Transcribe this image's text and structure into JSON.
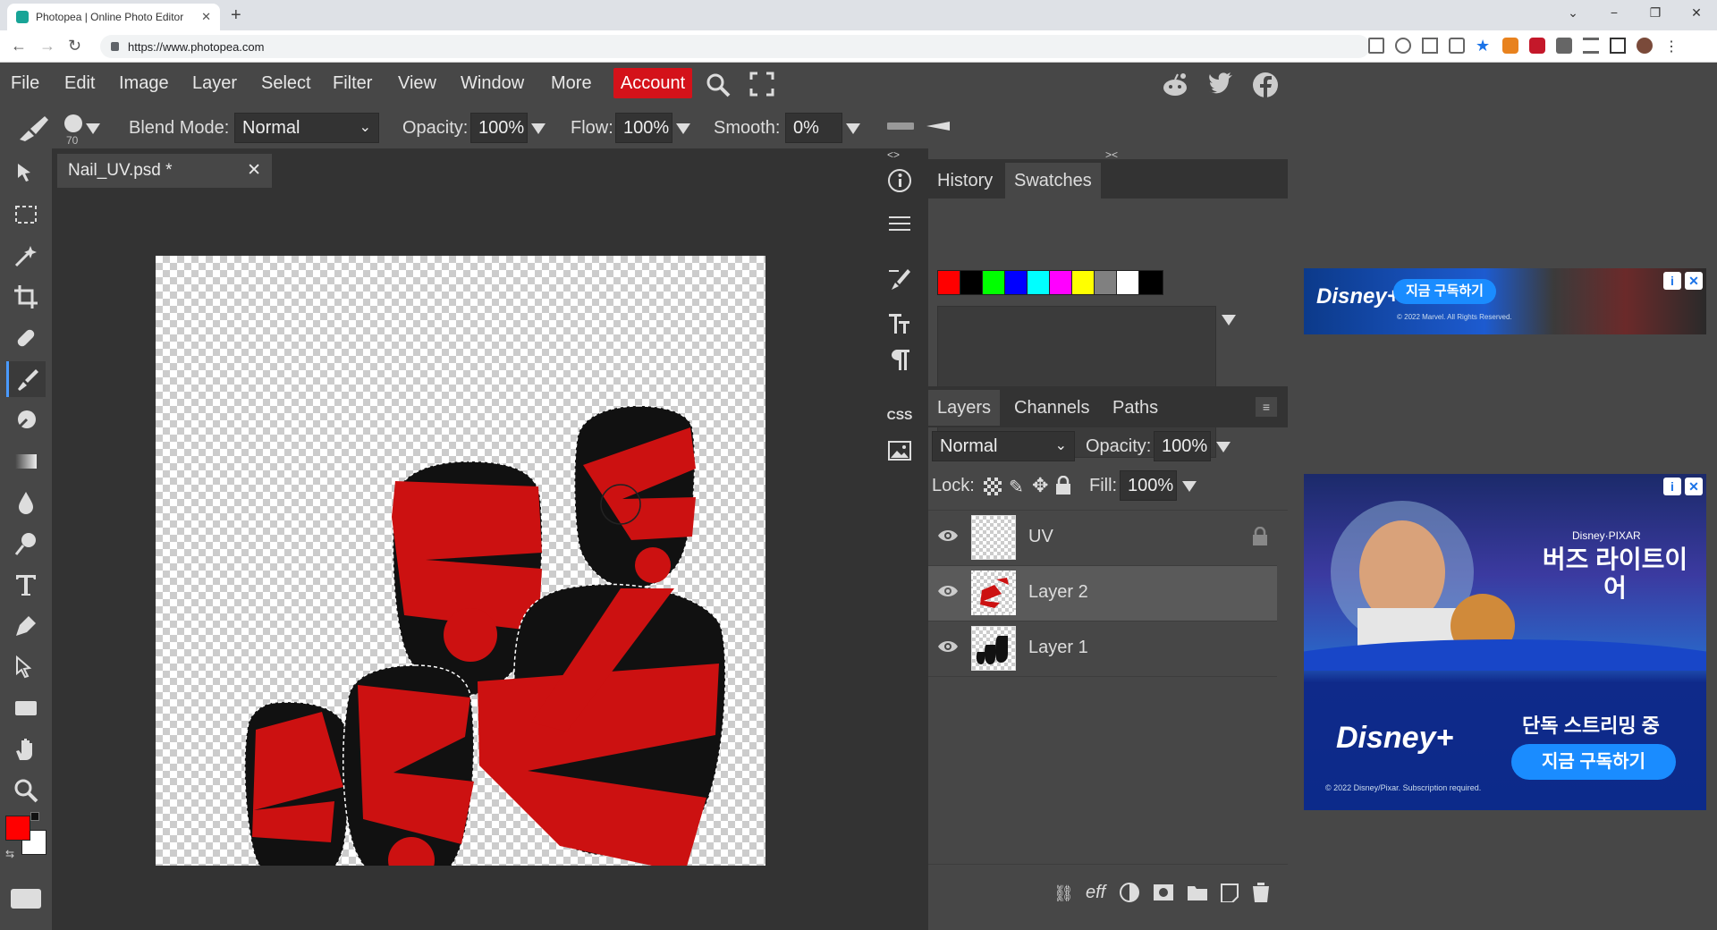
{
  "browser": {
    "tab_title": "Photopea | Online Photo Editor",
    "url": "https://www.photopea.com",
    "new_tab": "+",
    "tab_close": "✕",
    "win_min": "−",
    "win_max": "❐",
    "win_close": "✕"
  },
  "menu": {
    "items": [
      "File",
      "Edit",
      "Image",
      "Layer",
      "Select",
      "Filter",
      "View",
      "Window",
      "More"
    ],
    "account": "Account"
  },
  "options": {
    "brush_size": "70",
    "blend_mode_label": "Blend Mode:",
    "blend_mode_value": "Normal",
    "opacity_label": "Opacity:",
    "opacity_value": "100%",
    "flow_label": "Flow:",
    "flow_value": "100%",
    "smooth_label": "Smooth:",
    "smooth_value": "0%"
  },
  "document": {
    "tab_label": "Nail_UV.psd *",
    "close": "✕"
  },
  "colors": {
    "foreground": "#ff0000",
    "background": "#ffffff",
    "accent": "#d4121a",
    "paint_red": "#cc1111",
    "paint_black": "#111111"
  },
  "top_panel": {
    "tabs": [
      "History",
      "Swatches"
    ],
    "active": "Swatches",
    "collapse_left": "<>",
    "collapse_right": "><",
    "swatches": [
      "#ff0000",
      "#000000",
      "#00ff00",
      "#0000ff",
      "#00ffff",
      "#ff00ff",
      "#ffff00",
      "#808080",
      "#ffffff",
      "#000000"
    ]
  },
  "layers_panel": {
    "tabs": [
      "Layers",
      "Channels",
      "Paths"
    ],
    "active": "Layers",
    "blend_value": "Normal",
    "opacity_label": "Opacity:",
    "opacity_value": "100%",
    "lock_label": "Lock:",
    "fill_label": "Fill:",
    "fill_value": "100%",
    "layers": [
      {
        "name": "UV",
        "locked": true,
        "visible": true,
        "selected": false
      },
      {
        "name": "Layer 2",
        "locked": false,
        "visible": true,
        "selected": true
      },
      {
        "name": "Layer 1",
        "locked": false,
        "visible": true,
        "selected": false
      }
    ],
    "footer_eff": "eff"
  },
  "strip_icons": {
    "css_label": "CSS"
  },
  "ads": {
    "ad1_button": "지금 구독하기",
    "ad1_brand": "Disney+",
    "ad1_fine": "© 2022 Marvel. All Rights Reserved.",
    "ad2_brand_top": "Disney·PIXAR",
    "ad2_title": "버즈 라이트이어",
    "ad2_tagline": "단독 스트리밍 중",
    "ad2_button": "지금 구독하기",
    "ad2_brand": "Disney+",
    "ad2_fine": "© 2022 Disney/Pixar. Subscription required.",
    "info": "i",
    "close": "✕"
  }
}
